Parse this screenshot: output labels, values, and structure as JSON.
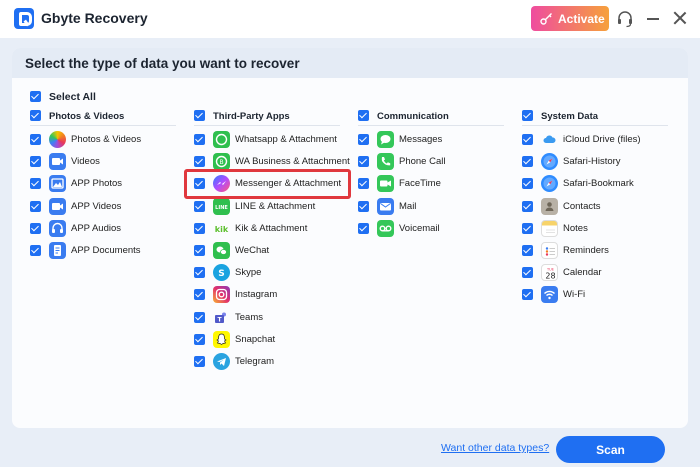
{
  "app": {
    "title": "Gbyte Recovery"
  },
  "titlebar": {
    "activate_label": "Activate"
  },
  "panel": {
    "title": "Select the type of data you want to recover",
    "select_all_label": "Select All"
  },
  "categories": [
    {
      "name": "Photos & Videos",
      "items": [
        "Photos & Videos",
        "Videos",
        "APP Photos",
        "APP Videos",
        "APP Audios",
        "APP Documents"
      ]
    },
    {
      "name": "Third-Party Apps",
      "items": [
        "Whatsapp & Attachment",
        "WA Business & Attachment",
        "Messenger & Attachment",
        "LINE & Attachment",
        "Kik & Attachment",
        "WeChat",
        "Skype",
        "Instagram",
        "Teams",
        "Snapchat",
        "Telegram"
      ]
    },
    {
      "name": "Communication",
      "items": [
        "Messages",
        "Phone Call",
        "FaceTime",
        "Mail",
        "Voicemail"
      ]
    },
    {
      "name": "System Data",
      "items": [
        "iCloud Drive (files)",
        "Safari-History",
        "Safari-Bookmark",
        "Contacts",
        "Notes",
        "Reminders",
        "Calendar",
        "Wi-Fi"
      ]
    }
  ],
  "icons": {
    "c0": [
      "photos-icon",
      "videos-icon",
      "app-photos-icon",
      "app-videos-icon",
      "app-audios-icon",
      "app-documents-icon"
    ],
    "c1": [
      "whatsapp-icon",
      "wa-business-icon",
      "messenger-icon",
      "line-icon",
      "kik-icon",
      "wechat-icon",
      "skype-icon",
      "instagram-icon",
      "teams-icon",
      "snapchat-icon",
      "telegram-icon"
    ],
    "c2": [
      "messages-icon",
      "phone-call-icon",
      "facetime-icon",
      "mail-icon",
      "voicemail-icon"
    ],
    "c3": [
      "icloud-drive-icon",
      "safari-history-icon",
      "safari-bookmark-icon",
      "contacts-icon",
      "notes-icon",
      "reminders-icon",
      "calendar-icon",
      "wifi-icon"
    ]
  },
  "calendar_icon_text": {
    "month": "TUE",
    "day": "28"
  },
  "footer": {
    "other_link": "Want other data types?",
    "scan_label": "Scan"
  },
  "colors": {
    "accent": "#1f6ff2",
    "highlight": "#e0383e"
  }
}
